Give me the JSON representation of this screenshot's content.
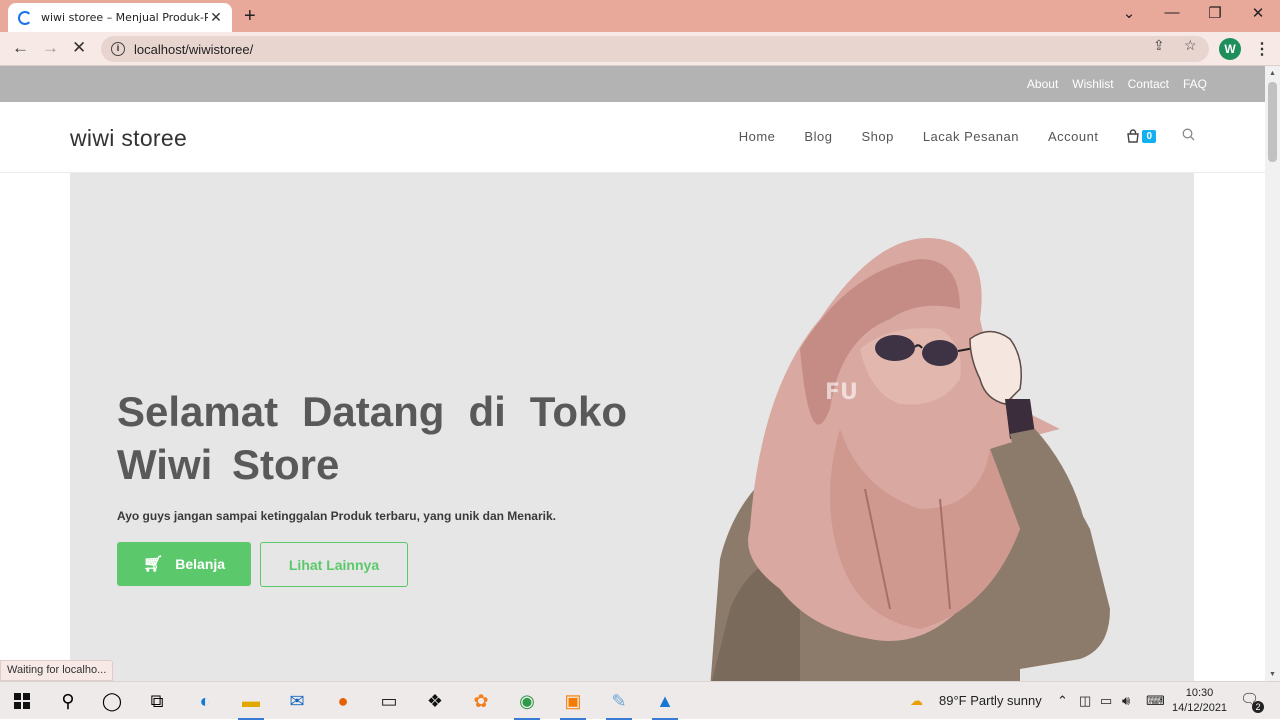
{
  "browser": {
    "tab_title": "wiwi storee – Menjual Produk-Pr",
    "url": "localhost/wiwistoree/",
    "profile_initial": "W",
    "status_text": "Waiting for localho..."
  },
  "topbar": {
    "links": [
      "About",
      "Wishlist",
      "Contact",
      "FAQ"
    ]
  },
  "header": {
    "logo": "wiwi storee",
    "nav": [
      "Home",
      "Blog",
      "Shop",
      "Lacak Pesanan",
      "Account"
    ],
    "cart_count": "0"
  },
  "hero": {
    "title": "Selamat Datang di Toko Wiwi Store",
    "subtitle": "Ayo guys jangan sampai ketinggalan Produk terbaru, yang unik dan Menarik.",
    "primary_button": "Belanja",
    "secondary_button": "Lihat Lainnya",
    "illustration_watermark": "FU"
  },
  "taskbar": {
    "weather": "89°F  Partly sunny",
    "time": "10:30",
    "date": "14/12/2021",
    "notifications": "2"
  },
  "colors": {
    "accent_green": "#5bc96b",
    "cart_badge": "#13aff0",
    "hero_bg": "#e6e6e6",
    "chrome_frame": "#e8a99a"
  }
}
